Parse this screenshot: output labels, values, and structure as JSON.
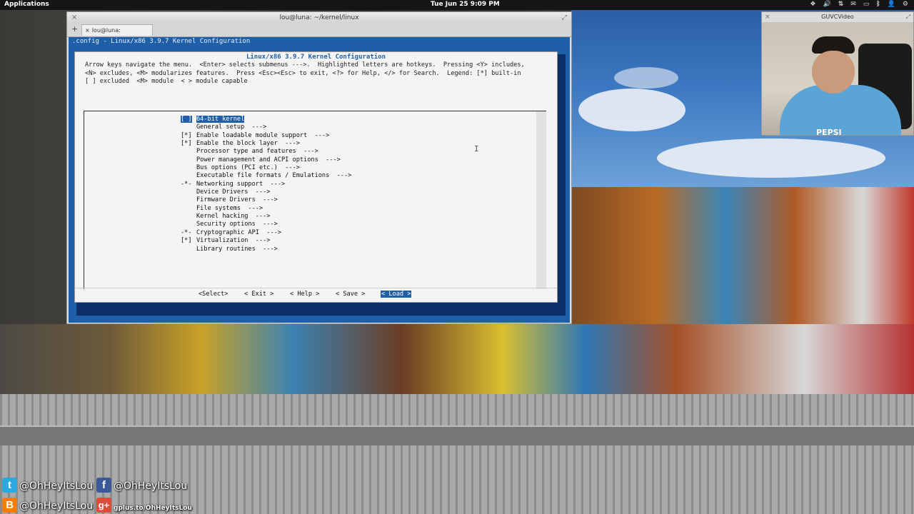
{
  "top_panel": {
    "applications": "Applications",
    "clock": "Tue Jun 25  9:09 PM"
  },
  "terminal": {
    "title": "lou@luna: ~/kernel/linux",
    "tab_label": "lou@luna: ~/kernel/linux",
    "header": ".config - Linux/x86 3.9.7 Kernel Configuration",
    "menuconfig": {
      "title": "Linux/x86 3.9.7 Kernel Configuration",
      "help_lines": [
        "Arrow keys navigate the menu.  <Enter> selects submenus --->.  Highlighted letters are hotkeys.  Pressing <Y> includes,",
        "<N> excludes, <M> modularizes features.  Press <Esc><Esc> to exit, <?> for Help, </> for Search.  Legend: [*] built-in",
        "[ ] excluded  <M> module  < > module capable"
      ],
      "items": [
        {
          "mark": "[ ]",
          "label": "64-bit kernel",
          "selected": true
        },
        {
          "mark": "",
          "label": "General setup  --->",
          "selected": false
        },
        {
          "mark": "[*]",
          "label": "Enable loadable module support  --->",
          "selected": false
        },
        {
          "mark": "[*]",
          "label": "Enable the block layer  --->",
          "selected": false
        },
        {
          "mark": "",
          "label": "Processor type and features  --->",
          "selected": false
        },
        {
          "mark": "",
          "label": "Power management and ACPI options  --->",
          "selected": false
        },
        {
          "mark": "",
          "label": "Bus options (PCI etc.)  --->",
          "selected": false
        },
        {
          "mark": "",
          "label": "Executable file formats / Emulations  --->",
          "selected": false
        },
        {
          "mark": "-*-",
          "label": "Networking support  --->",
          "selected": false
        },
        {
          "mark": "",
          "label": "Device Drivers  --->",
          "selected": false
        },
        {
          "mark": "",
          "label": "Firmware Drivers  --->",
          "selected": false
        },
        {
          "mark": "",
          "label": "File systems  --->",
          "selected": false
        },
        {
          "mark": "",
          "label": "Kernel hacking  --->",
          "selected": false
        },
        {
          "mark": "",
          "label": "Security options  --->",
          "selected": false
        },
        {
          "mark": "-*-",
          "label": "Cryptographic API  --->",
          "selected": false
        },
        {
          "mark": "[*]",
          "label": "Virtualization  --->",
          "selected": false
        },
        {
          "mark": "",
          "label": "Library routines  --->",
          "selected": false
        }
      ],
      "buttons": {
        "select": "<Select>",
        "exit": "< Exit >",
        "help": "< Help >",
        "save": "< Save >",
        "load": "< Load >"
      }
    }
  },
  "webcam": {
    "title": "GUVCVideo",
    "shirt_logo": "PEPSI"
  },
  "social": {
    "twitter_handle": "@OhHeyItsLou",
    "facebook_handle": "@OhHeyItsLou",
    "blogger_handle": "@OhHeyItsLou",
    "gplus_url": "gplus.to/OhHeyItsLou"
  },
  "colors": {
    "terminal_bg": "#1f5fa8",
    "selection": "#1f5fa8",
    "panel": "#151515"
  }
}
